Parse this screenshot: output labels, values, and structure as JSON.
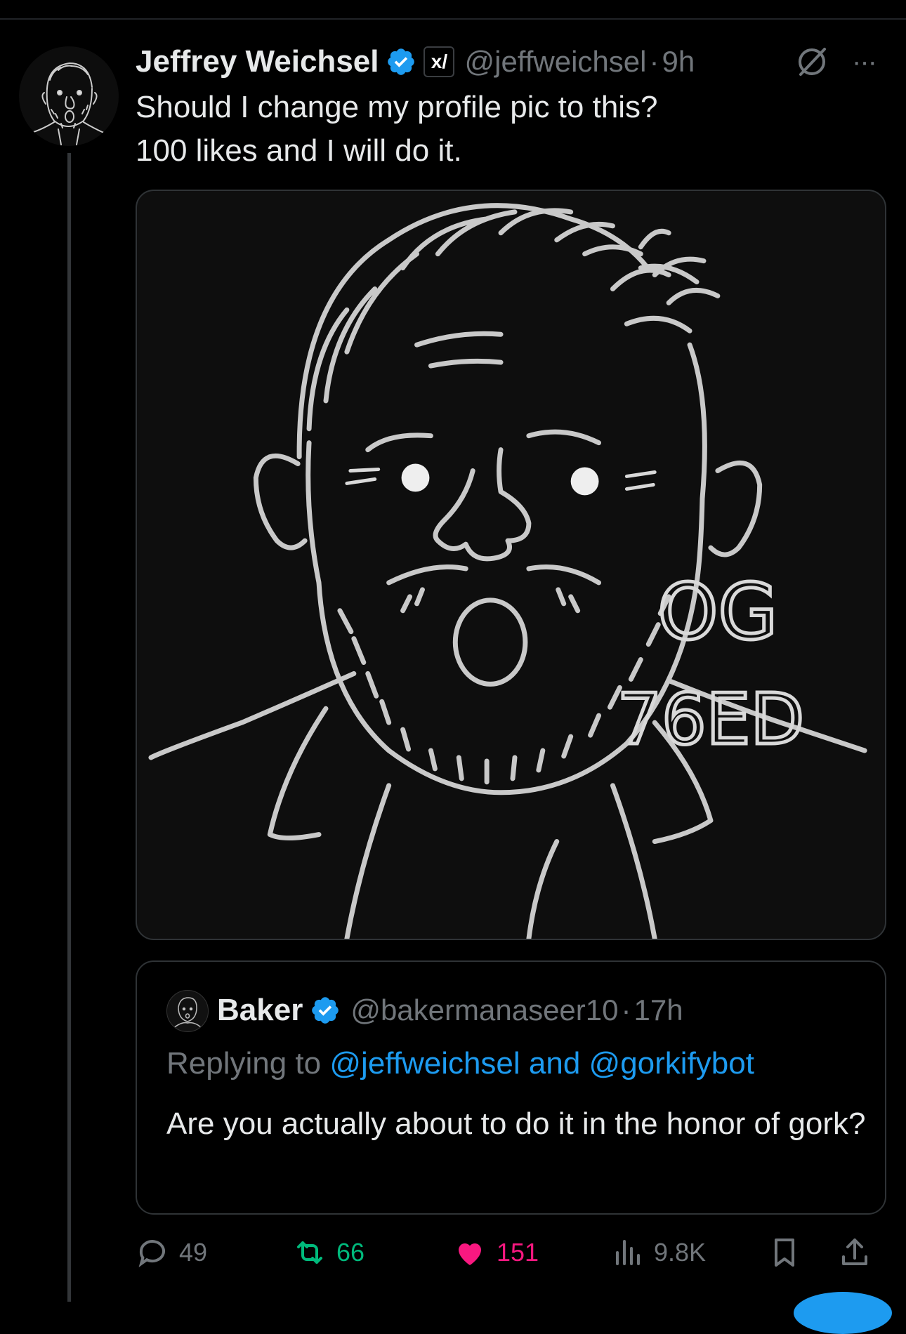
{
  "tweet": {
    "author_name": "Jeffrey Weichsel",
    "handle": "@jeffweichsel",
    "separator": "·",
    "time": "9h",
    "affiliate_badge": "x/",
    "text_line1": "Should I change my profile pic to this?",
    "text_line2": "100 likes and I will do it.",
    "image_caption_line1": "OG",
    "image_caption_line2": "76ED"
  },
  "quote": {
    "author_name": "Baker",
    "handle": "@bakermanaseer10",
    "separator": "·",
    "time": "17h",
    "replying_prefix": "Replying to",
    "replying_to": "@jeffweichsel and @gorkifybot",
    "text": "Are you actually about to do it in the honor of gork?"
  },
  "actions": {
    "replies": "49",
    "reposts": "66",
    "likes": "151",
    "views": "9.8K"
  },
  "colors": {
    "background": "#000000",
    "text": "#e7e9ea",
    "muted": "#71767b",
    "link": "#1d9bf0",
    "repost_green": "#00ba7c",
    "like_pink": "#f91880"
  },
  "icons": {
    "verified": "verified-badge-icon",
    "grok": "grok-icon",
    "more": "more-icon",
    "reply": "reply-icon",
    "repost": "repost-icon",
    "like": "heart-icon",
    "views": "views-icon",
    "bookmark": "bookmark-icon",
    "share": "share-icon"
  }
}
